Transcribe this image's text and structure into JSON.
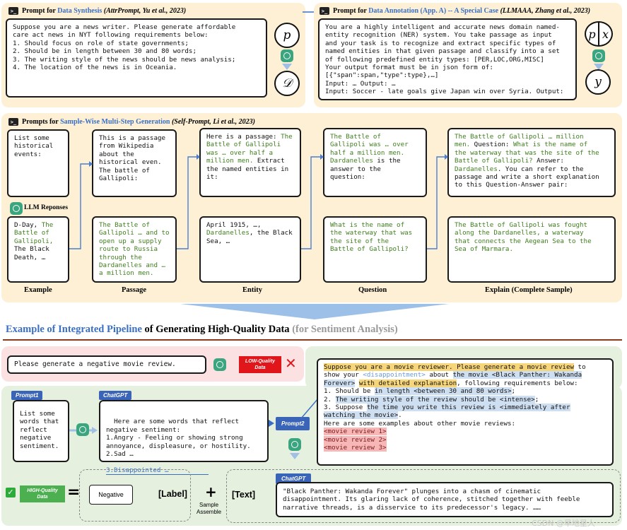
{
  "top_left": {
    "title_prefix": "Prompt for ",
    "title_link": "Data Synthesis",
    "title_ref": " (AttrPrompt, Yu et al., 2023)",
    "prompt": "Suppose you are a news writer. Please generate affordable\ncare act news in NYT following requirements below:\n1. Should focus on role of state governments;\n2. Should be in length between 30 and 80 words;\n3. The writing style of the news should be news analysis;\n4. The location of the news is in Oceania.",
    "circle_top": "p",
    "circle_bottom": "𝒟"
  },
  "top_right": {
    "title_prefix": "Prompt for ",
    "title_link": "Data Annotation (App. A) -- A Special Case",
    "title_ref": " (LLMAAA, Zhang et al., 2023)",
    "prompt": "You are a highly intelligent and accurate news domain named-\nentity recognition (NER) system. You take passage as input\nand your task is to recognize and extract specific types of\nnamed entities in that given passage and classify into a set\nof following predefined entity types: [PER,LOC,ORG,MISC]\nYour output format must be in json form of:\n[{\"span\":span,\"type\":type},…]\nInput: … Output: …\nInput: Soccer - late goals give Japan win over Syria. Output:",
    "circle_p": "p",
    "circle_x": "x",
    "circle_y": "y"
  },
  "middle": {
    "title_prefix": "Prompts for ",
    "title_link": "Sample-Wise Multi-Step Generation",
    "title_ref": " (Self-Prompt, Li et al., 2023)",
    "llm_label": "LLM Reponses",
    "example_prompt": "List some\nhistorical\nevents:",
    "example_resp_a": "D-Day, ",
    "example_resp_b": "The\nBattle of\nGallipoli,",
    "example_resp_c": "\nThe Black\nDeath, …",
    "passage_prompt": "This is a passage\nfrom Wikipedia\nabout the\nhistorical even.\nThe battle of\nGallipoli:",
    "passage_resp": "The Battle of\nGallipoli … and to\nopen up a supply\nroute to Russia\nthrough the\nDardanelles and …\na million men.",
    "entity_prompt_a": "Here is a passage: ",
    "entity_prompt_b": "The\nBattle of Gallipoli\nwas … over half a\nmillion men.",
    "entity_prompt_c": " Extract\nthe named entities in\nit:",
    "entity_resp_a": "April 1915, …,\n",
    "entity_resp_b": "Dardanelles",
    "entity_resp_c": ", the Black\nSea, …",
    "question_prompt_a": "The Battle of\nGallipoli was … over\nhalf a million men.\nDardanelles",
    "question_prompt_b": " is the\nanswer to the question:",
    "question_resp": "What is the name of\nthe waterway that was\nthe site of the\nBattle of Gallipoli?",
    "explain_prompt_a": "The Battle of Gallipoli … million\nmen.",
    "explain_prompt_b": " Question: ",
    "explain_prompt_c": "What is the name of\nthe waterway that was the site of the\nBattle of Gallipoli?",
    "explain_prompt_d": " Answer:\n",
    "explain_prompt_e": "Dardanelles",
    "explain_prompt_f": ". You can refer to the\npassage and write a short explanation\nto this Question-Answer pair:",
    "explain_resp": "The Battle of Gallipoli was fought\nalong the Dardanelles, a waterway\nthat connects the Aegean Sea to the\nSea of Marmara.",
    "col_example": "Example",
    "col_passage": "Passage",
    "col_entity": "Entity",
    "col_question": "Question",
    "col_explain": "Explain (Complete Sample)"
  },
  "pipeline": {
    "title_a": "Example of Integrated Pipeline",
    "title_b": " of Generating High-Quality Data ",
    "title_c": "(for Sentiment Analysis)",
    "low_prompt": "Please generate a negative movie review.",
    "low_badge": "LOW-Quality\nData",
    "cross": "✕",
    "prompt1_tag": "Prompt1",
    "prompt1_text": "List some\nwords that\nreflect\nnegative\nsentiment.",
    "chatgpt_tag": "ChatGPT",
    "chatgpt_text": "Here are some words that reflect\nnegative sentiment:\n1.Angry - Feeling or showing strong\nannoyance, displeasure, or hostility.\n2.Sad …",
    "chatgpt_line3": "3.Disappointed …",
    "prompt2_tag": "Prompt2",
    "p2_a": "Suppose you are a movie reviewer. Please generate a movie review",
    "p2_b": " to\nshow your ",
    "p2_c": "<disappointment>",
    "p2_d": " about ",
    "p2_e": "the movie <Black Panther: Wakanda\nForever>",
    "p2_f": " ",
    "p2_g": "with detailed explanation",
    "p2_h": ", following requirements below:\n1. Should be ",
    "p2_i": "in length <between 30 and 80 words>",
    "p2_j": ";\n2. ",
    "p2_k": "The writing style of the review should be <intense>",
    "p2_l": ";\n3. Suppose ",
    "p2_m": "the time you write this review is <immediately after\nwatching the movie>",
    "p2_n": ".\nHere are some examples about other movie reviews:\n",
    "p2_r1": "<movie review 1>",
    "p2_r2": "<movie review 2>",
    "p2_r3": "<movie review 3>",
    "high_badge": "HIGH-Quality\nData",
    "equals": "=",
    "label_value": "Negative",
    "label_tag": "[Label]",
    "plus": "+",
    "sample_assemble": "Sample\nAssemble",
    "text_tag": "[Text]",
    "chatgpt2_tag": "ChatGPT",
    "final_text": "\"Black Panther: Wakanda Forever\" plunges into a chasm of cinematic\ndisappointment. Its glaring lack of coherence, stitched together with feeble\nnarrative threads, is a disservice to its predecessor's legacy. ……",
    "watermark": "CSDN @旱地星人"
  }
}
